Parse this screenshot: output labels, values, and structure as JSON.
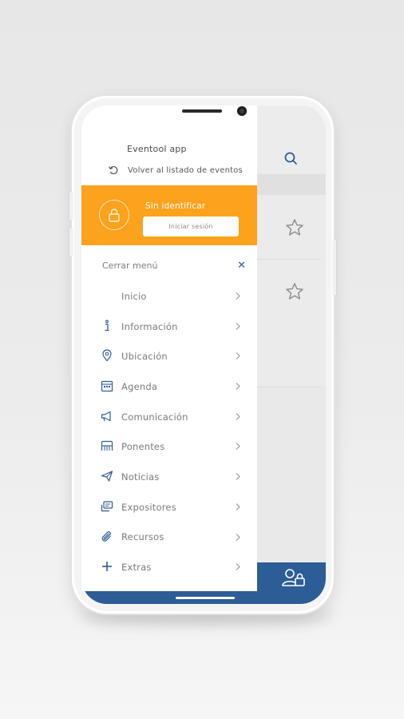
{
  "app": {
    "name": "Eventool app",
    "back_label": "Volver al listado de eventos"
  },
  "user_panel": {
    "status": "Sin identificar",
    "login_button": "Iniciar sesión",
    "color": "#fda21d"
  },
  "menu": {
    "close_label": "Cerrar menú",
    "items": [
      {
        "label": "Inicio",
        "icon": "none"
      },
      {
        "label": "Información",
        "icon": "info-icon"
      },
      {
        "label": "Ubicación",
        "icon": "location-pin-icon"
      },
      {
        "label": "Agenda",
        "icon": "calendar-icon"
      },
      {
        "label": "Comunicación",
        "icon": "megaphone-icon"
      },
      {
        "label": "Ponentes",
        "icon": "podium-icon"
      },
      {
        "label": "Noticias",
        "icon": "paper-plane-icon"
      },
      {
        "label": "Expositores",
        "icon": "exhibitor-icon"
      },
      {
        "label": "Recursos",
        "icon": "paperclip-icon"
      },
      {
        "label": "Extras",
        "icon": "plus-icon"
      }
    ]
  },
  "background_app": {
    "icons": [
      "search-icon",
      "star-icon",
      "star-icon",
      "user-lock-icon"
    ]
  },
  "colors": {
    "primary_blue": "#2c5d97",
    "accent_orange": "#fda21d"
  }
}
